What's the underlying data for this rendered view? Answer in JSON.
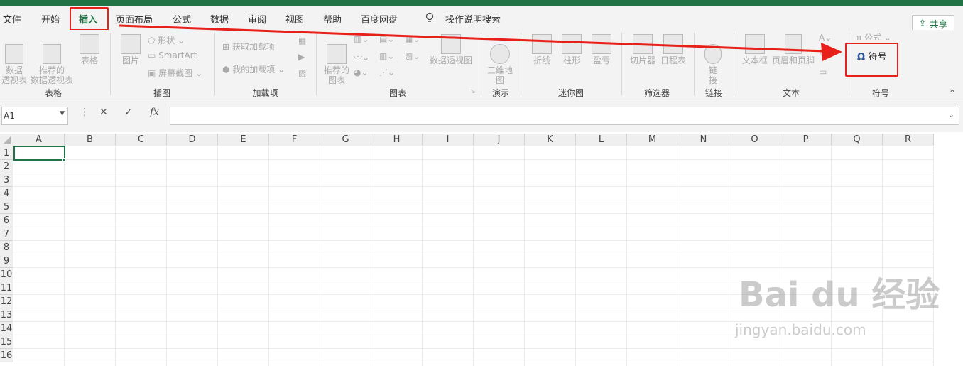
{
  "tabs": [
    "文件",
    "开始",
    "插入",
    "页面布局",
    "公式",
    "数据",
    "审阅",
    "视图",
    "帮助",
    "百度网盘"
  ],
  "tell_me": "操作说明搜索",
  "share": "共享",
  "ribbon": {
    "pivot": "数据\n透视表",
    "rec_pivot": "推荐的\n数据透视表",
    "table": "表格",
    "group_table": "表格",
    "pictures": "图片",
    "shapes": "形状",
    "smartart": "SmartArt",
    "screenshot": "屏幕截图",
    "group_illus": "插图",
    "get_addins": "获取加载项",
    "my_addins": "我的加载项",
    "group_addins": "加载项",
    "rec_charts": "推荐的\n图表",
    "pivot_chart": "数据透视图",
    "group_charts": "图表",
    "map3d": "三维地\n图",
    "group_tours": "演示",
    "sp_line": "折线",
    "sp_col": "柱形",
    "sp_wl": "盈亏",
    "group_spark": "迷你图",
    "slicer": "切片器",
    "timeline": "日程表",
    "group_filters": "筛选器",
    "link": "链\n接",
    "group_links": "链接",
    "textbox": "文本框",
    "header_footer": "页眉和页脚",
    "group_text": "文本",
    "equation": "公式",
    "symbol": "符号",
    "group_symbols": "符号"
  },
  "formula_bar": {
    "name_box": "A1",
    "cancel": "✕",
    "enter": "✓",
    "fx": "fx"
  },
  "columns": [
    "A",
    "B",
    "C",
    "D",
    "E",
    "F",
    "G",
    "H",
    "I",
    "J",
    "K",
    "L",
    "M",
    "N",
    "O",
    "P",
    "Q",
    "R"
  ],
  "rows": [
    "1",
    "2",
    "3",
    "4",
    "5",
    "6",
    "7",
    "8",
    "9",
    "10",
    "11",
    "12",
    "13",
    "14",
    "15",
    "16"
  ],
  "watermark": {
    "brand": "Bai du 经验",
    "url": "jingyan.baidu.com"
  },
  "colors": {
    "accent": "#217346",
    "highlight": "#e8201a"
  }
}
